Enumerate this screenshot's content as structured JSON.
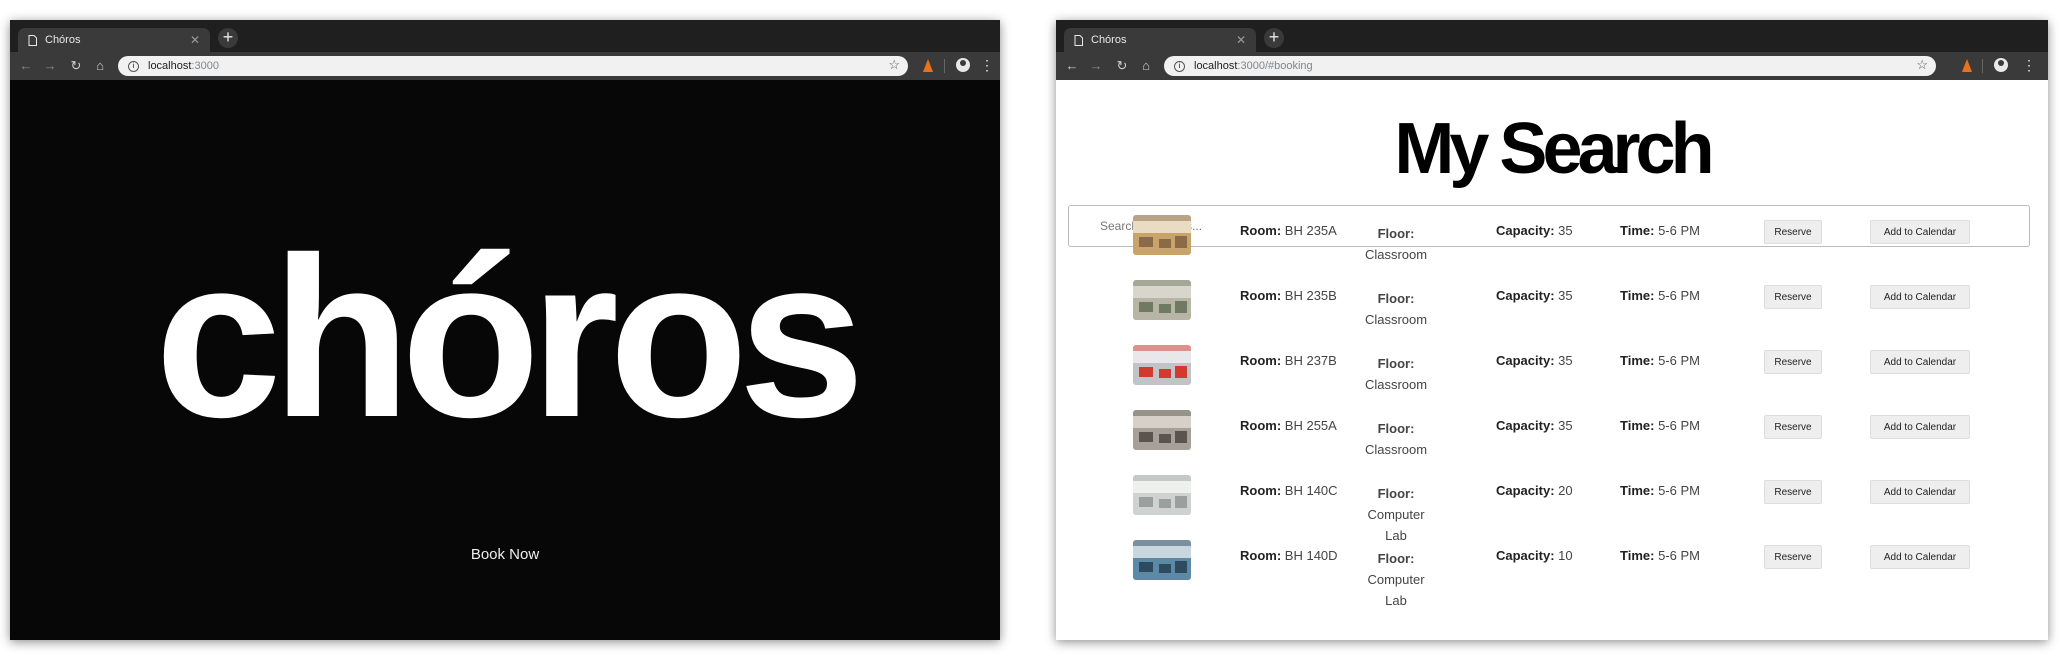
{
  "windows": [
    {
      "tab_title": "Chóros",
      "url_host": "localhost",
      "url_path": ":3000",
      "hero_text": "chóros",
      "cta_label": "Book Now"
    },
    {
      "tab_title": "Chóros",
      "url_host": "localhost",
      "url_path": ":3000/#booking",
      "page_title": "My Search",
      "search_placeholder": "Search for rooms...",
      "labels": {
        "room": "Room:",
        "floor": "Floor:",
        "capacity": "Capacity:",
        "time": "Time:"
      },
      "buttons": {
        "reserve": "Reserve",
        "calendar": "Add to Calendar"
      },
      "rooms": [
        {
          "room": "BH 235A",
          "floor": "Classroom",
          "capacity": "35",
          "time": "5-6 PM"
        },
        {
          "room": "BH 235B",
          "floor": "Classroom",
          "capacity": "35",
          "time": "5-6 PM"
        },
        {
          "room": "BH 237B",
          "floor": "Classroom",
          "capacity": "35",
          "time": "5-6 PM"
        },
        {
          "room": "BH 255A",
          "floor": "Classroom",
          "capacity": "35",
          "time": "5-6 PM"
        },
        {
          "room": "BH 140C",
          "floor": "Computer Lab",
          "capacity": "20",
          "time": "5-6 PM"
        },
        {
          "room": "BH 140D",
          "floor": "Computer Lab",
          "capacity": "10",
          "time": "5-6 PM"
        }
      ]
    }
  ],
  "icons": {
    "tab": "document-icon",
    "close": "close-icon",
    "new_tab": "plus-icon",
    "back": "back-arrow-icon",
    "forward": "forward-arrow-icon",
    "reload": "reload-icon",
    "home": "home-icon",
    "info": "info-icon",
    "bookmark": "star-icon",
    "extension": "extension-icon",
    "account": "account-icon",
    "menu": "menu-dots-icon"
  }
}
